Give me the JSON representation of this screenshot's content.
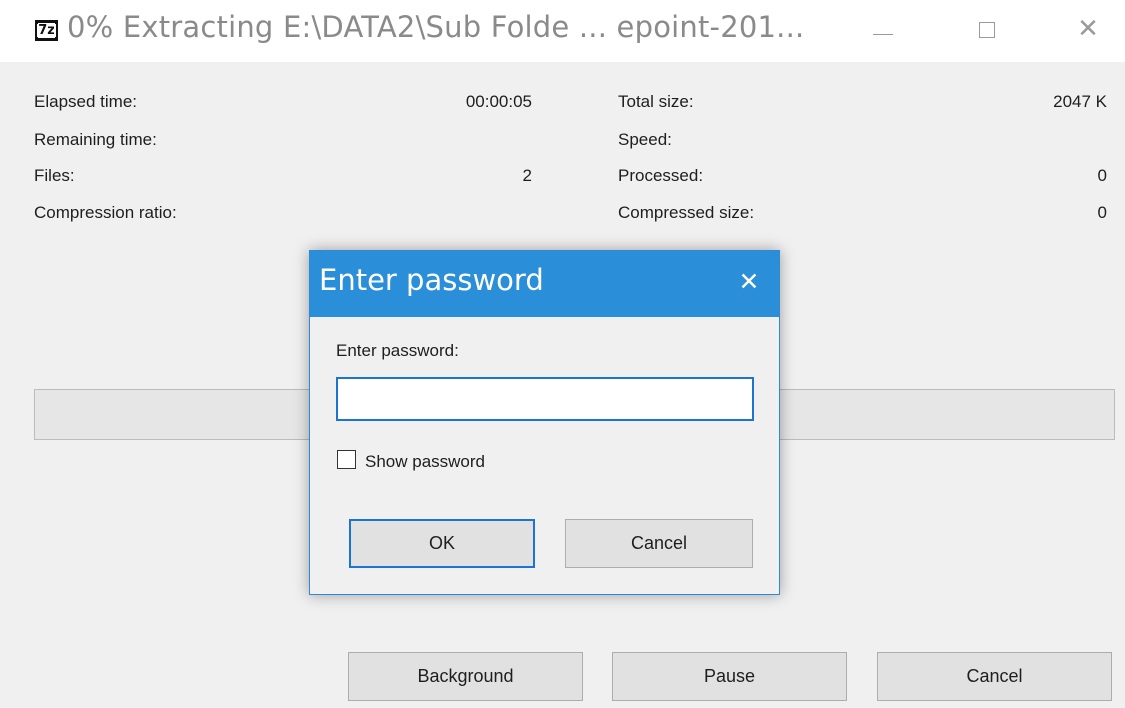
{
  "window": {
    "title": "0% Extracting E:\\DATA2\\Sub Folde ... epoint-201...",
    "icon_text": "7z",
    "minimize_icon": "minimize-icon",
    "maximize_icon": "maximize-icon",
    "close_icon": "close-icon"
  },
  "stats": {
    "elapsed_label": "Elapsed time:",
    "elapsed_value": "00:00:05",
    "remaining_label": "Remaining time:",
    "remaining_value": "",
    "files_label": "Files:",
    "files_value": "2",
    "ratio_label": "Compression ratio:",
    "ratio_value": "",
    "total_label": "Total size:",
    "total_value": "2047 K",
    "speed_label": "Speed:",
    "speed_value": "",
    "processed_label": "Processed:",
    "processed_value": "0",
    "compressed_label": "Compressed size:",
    "compressed_value": "0"
  },
  "progress": {
    "percent": 0
  },
  "buttons": {
    "background": "Background",
    "pause": "Pause",
    "cancel": "Cancel"
  },
  "dialog": {
    "title": "Enter password",
    "close_glyph": "✕",
    "prompt": "Enter password:",
    "password_value": "",
    "show_password_label": "Show password",
    "show_password_checked": false,
    "ok": "OK",
    "cancel": "Cancel"
  },
  "colors": {
    "dialog_title_bg": "#2b8ed8",
    "focus_border": "#1b73d4"
  }
}
